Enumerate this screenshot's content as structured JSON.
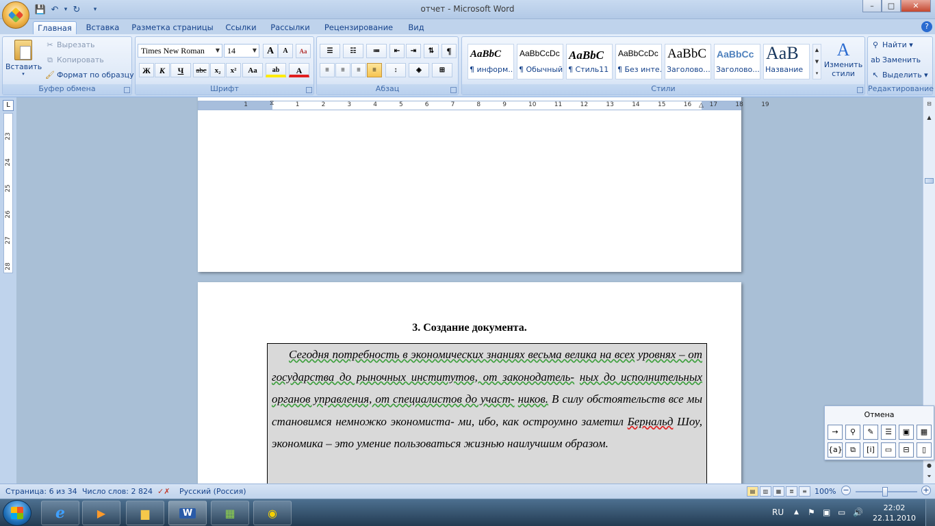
{
  "window": {
    "title": "отчет - Microsoft Word",
    "controls": {
      "minimize": "–",
      "maximize": "□",
      "close": "✕"
    }
  },
  "qat": {
    "save": "💾",
    "undo": "↶",
    "undo_dd": "▾",
    "redo": "↻",
    "customize": "▾"
  },
  "tabs": [
    "Главная",
    "Вставка",
    "Разметка страницы",
    "Ссылки",
    "Рассылки",
    "Рецензирование",
    "Вид"
  ],
  "active_tab": "Главная",
  "ribbon": {
    "clipboard": {
      "label": "Буфер обмена",
      "paste": "Вставить",
      "cut": "Вырезать",
      "copy": "Копировать",
      "format_painter": "Формат по образцу"
    },
    "font": {
      "label": "Шрифт",
      "font_name": "Times New Roman",
      "font_size": "14",
      "grow": "A",
      "shrink": "A",
      "clear": "Aa",
      "bold": "Ж",
      "italic": "К",
      "underline": "Ч",
      "strike": "abc",
      "subscript": "x₂",
      "superscript": "x²",
      "change_case": "Aa",
      "highlight": "ab",
      "font_color": "A"
    },
    "paragraph": {
      "label": "Абзац",
      "pilcrow": "¶"
    },
    "styles": {
      "label": "Стили",
      "items": [
        {
          "preview": "AaBbC",
          "name": "¶ информ..."
        },
        {
          "preview": "AaBbCcDc",
          "name": "¶ Обычный"
        },
        {
          "preview": "AaBbC",
          "name": "¶ Стиль11"
        },
        {
          "preview": "AaBbCcDc",
          "name": "¶ Без инте..."
        },
        {
          "preview": "AaBbC",
          "name": "Заголово..."
        },
        {
          "preview": "AaBbCc",
          "name": "Заголово..."
        },
        {
          "preview": "AaB",
          "name": "Название"
        }
      ],
      "change_styles": "Изменить стили"
    },
    "editing": {
      "label": "Редактирование",
      "find": "Найти",
      "replace": "Заменить",
      "select": "Выделить"
    }
  },
  "ruler": {
    "h_numbers": [
      "1",
      "1",
      "2",
      "3",
      "4",
      "5",
      "6",
      "7",
      "8",
      "9",
      "10",
      "11",
      "12",
      "13",
      "14",
      "15",
      "16",
      "17",
      "18",
      "19"
    ],
    "v_numbers": [
      "23",
      "24",
      "25",
      "26",
      "27",
      "28"
    ],
    "tab_selector": "L"
  },
  "document": {
    "heading": "3.  Создание документа.",
    "paragraph": {
      "line1": "Сегодня потребность в экономических знаниях весьма велика на всех",
      "line2": "уровнях – от государства до рыночных институтов, от законодатель-",
      "line3": "ных до исполнительных органов управления, от специалистов до участ-",
      "line4a": "ников.",
      "line4b": " В силу обстоятельств все мы становимся немножко экономиста-",
      "line5a": "ми, ибо, как остроумно  заметил ",
      "line5b": "Бернальд",
      "line5c": " Шоу, экономика – это умение",
      "line6": "пользоваться жизнью наилучшим образом."
    }
  },
  "floating_toolbar": {
    "title": "Отмена",
    "buttons_row1": [
      "→",
      "⚲",
      "✎",
      "☰",
      "▣",
      "▦"
    ],
    "buttons_row2": [
      "{a}",
      "⧉",
      "[i]",
      "▭",
      "⊟",
      "▯"
    ]
  },
  "statusbar": {
    "page": "Страница: 6 из 34",
    "words": "Число слов: 2 824",
    "language": "Русский (Россия)",
    "zoom": "100%",
    "zoom_minus": "−",
    "zoom_plus": "+"
  },
  "taskbar": {
    "language": "RU",
    "time": "22:02",
    "date": "22.11.2010"
  },
  "colors": {
    "ribbon_text": "#15428b",
    "document_bg": "#a9bfd6",
    "textbox_fill": "#d9d9d9"
  }
}
